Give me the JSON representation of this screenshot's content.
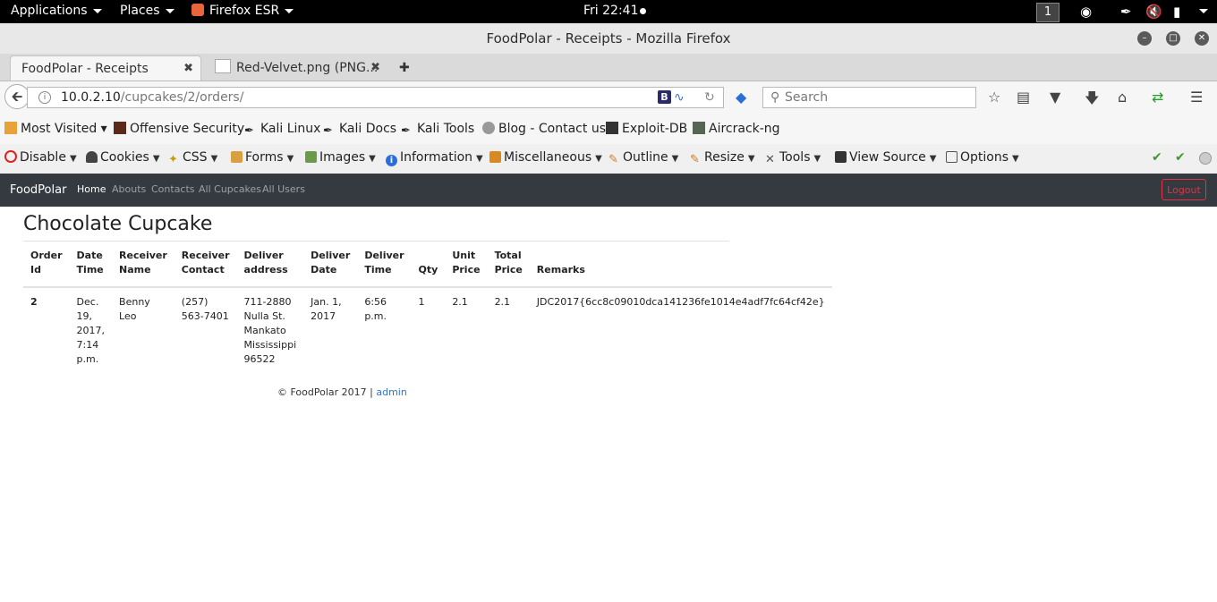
{
  "system_bar": {
    "applications": "Applications",
    "places": "Places",
    "active_app": "Firefox ESR",
    "clock": "Fri 22:41",
    "workspace": "1"
  },
  "window": {
    "title": "FoodPolar - Receipts - Mozilla Firefox"
  },
  "tabs": [
    {
      "label": "FoodPolar - Receipts",
      "close": "✖"
    },
    {
      "label": "Red-Velvet.png (PNG...",
      "close": "✖"
    }
  ],
  "new_tab": "✚",
  "address_bar": {
    "host": "10.0.2.10",
    "path": "/cupcakes/2/orders/",
    "search_placeholder": "Search"
  },
  "bookmarks": [
    "Most Visited ▾",
    "Offensive Security",
    "Kali Linux",
    "Kali Docs",
    "Kali Tools",
    "Blog - Contact us",
    "Exploit-DB",
    "Aircrack-ng"
  ],
  "webdev_toolbar": [
    "Disable",
    "Cookies",
    "CSS",
    "Forms",
    "Images",
    "Information",
    "Miscellaneous",
    "Outline",
    "Resize",
    "Tools",
    "View Source",
    "Options"
  ],
  "site_nav": {
    "brand": "FoodPolar",
    "links": [
      "Home",
      "Abouts",
      "Contacts",
      "All Cupcakes",
      "All Users"
    ],
    "logout": "Logout"
  },
  "page": {
    "title": "Chocolate Cupcake",
    "columns": [
      "Order Id",
      "Date Time",
      "Receiver Name",
      "Receiver Contact",
      "Deliver address",
      "Deliver Date",
      "Deliver Time",
      "Qty",
      "Unit Price",
      "Total Price",
      "Remarks"
    ],
    "rows": [
      {
        "order_id": "2",
        "date_time": "Dec. 19, 2017, 7:14 p.m.",
        "receiver_name": "Benny Leo",
        "receiver_contact": "(257) 563-7401",
        "deliver_address": "711-2880 Nulla St. Mankato Mississippi 96522",
        "deliver_date": "Jan. 1, 2017",
        "deliver_time": "6:56 p.m.",
        "qty": "1",
        "unit_price": "2.1",
        "total_price": "2.1",
        "remarks": "JDC2017{6cc8c09010dca141236fe1014e4adf7fc64cf42e}"
      }
    ],
    "footer_text": "© FoodPolar 2017 | ",
    "footer_link": "admin"
  },
  "colors": {
    "site_nav_bg": "#343a40",
    "logout": "#dc3545",
    "link": "#2a75c9"
  }
}
